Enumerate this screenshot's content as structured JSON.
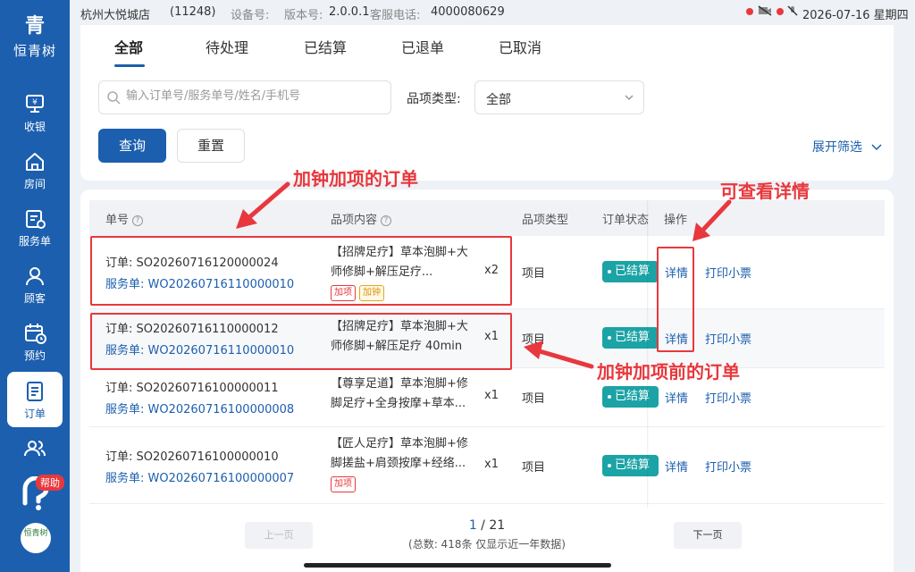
{
  "brand": {
    "logo": "青",
    "name": "恒青树"
  },
  "nav": [
    {
      "label": "收银",
      "icon": "cashier-icon"
    },
    {
      "label": "房间",
      "icon": "room-icon"
    },
    {
      "label": "服务单",
      "icon": "service-order-icon"
    },
    {
      "label": "顾客",
      "icon": "customer-icon"
    },
    {
      "label": "预约",
      "icon": "calendar-icon"
    },
    {
      "label": "订单",
      "icon": "order-icon",
      "active": true
    },
    {
      "label": "",
      "icon": "staff-icon"
    }
  ],
  "help": {
    "badge": "帮助"
  },
  "bottom_logo": "恒青树",
  "statusbar": {
    "store": "杭州大悦城店",
    "code": "(11248)",
    "device_label": "设备号:",
    "version_label": "版本号:",
    "version": "2.0.0.1",
    "phone_label": "客服电话:",
    "phone": "4000080629",
    "datetime": "2026-07-16 星期四"
  },
  "tabs": [
    "全部",
    "待处理",
    "已结算",
    "已退单",
    "已取消"
  ],
  "search": {
    "placeholder": "输入订单号/服务单号/姓名/手机号"
  },
  "category": {
    "label": "品项类型:",
    "value": "全部"
  },
  "buttons": {
    "query": "查询",
    "reset": "重置",
    "expand": "展开筛选"
  },
  "table": {
    "headers": {
      "order_no": "单号",
      "content": "品项内容",
      "category": "品项类型",
      "status": "订单状态",
      "ops": "操作"
    },
    "rows": [
      {
        "order": "订单: SO20260716120000024",
        "service": "服务单: WO20260716110000010",
        "content": "【招牌足疗】草本泡脚+大师修脚+解压足疗...",
        "qty": "x2",
        "category": "项目",
        "status": "已结算",
        "detail": "详情",
        "print": "打印小票",
        "tags": [
          "加项",
          "加钟"
        ]
      },
      {
        "order": "订单: SO20260716110000012",
        "service": "服务单: WO20260716110000010",
        "content": "【招牌足疗】草本泡脚+大师修脚+解压足疗 40min",
        "qty": "x1",
        "category": "项目",
        "status": "已结算",
        "detail": "详情",
        "print": "打印小票",
        "tags": []
      },
      {
        "order": "订单: SO20260716100000011",
        "service": "服务单: WO20260716100000008",
        "content": "【尊享足道】草本泡脚+修脚足疗+全身按摩+草本...",
        "qty": "x1",
        "category": "项目",
        "status": "已结算",
        "detail": "详情",
        "print": "打印小票",
        "tags": []
      },
      {
        "order": "订单: SO20260716100000010",
        "service": "服务单: WO20260716100000007",
        "content": "【匠人足疗】草本泡脚+修脚搓盐+肩颈按摩+经络...",
        "qty": "x1",
        "category": "项目",
        "status": "已结算",
        "detail": "详情",
        "print": "打印小票",
        "tags": [
          "加项"
        ]
      }
    ]
  },
  "pager": {
    "prev": "上一页",
    "next": "下一页",
    "current": "1",
    "sep": " / ",
    "total_pages": "21",
    "summary": "(总数: 418条 仅显示近一年数据)"
  },
  "annotations": {
    "after": "加钟加项的订单",
    "detail": "可查看详情",
    "before": "加钟加项前的订单"
  },
  "colors": {
    "brand": "#1c5fae",
    "status": "#1ba3a6",
    "annotation": "#e8383d"
  }
}
